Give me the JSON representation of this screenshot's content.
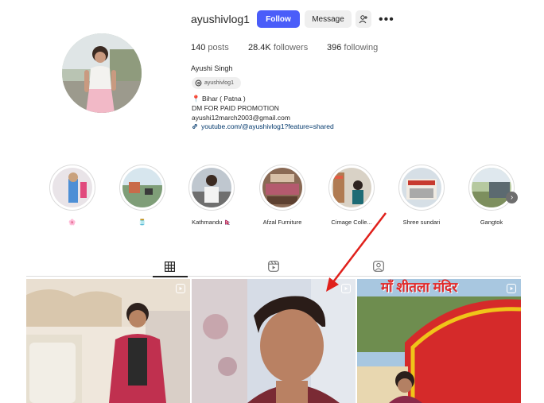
{
  "profile": {
    "username": "ayushivlog1",
    "follow_label": "Follow",
    "message_label": "Message",
    "more_label": "•••",
    "posts_count": "140",
    "posts_label": "posts",
    "followers_count": "28.4K",
    "followers_label": "followers",
    "following_count": "396",
    "following_label": "following",
    "full_name": "Ayushi Singh",
    "threads_handle": "ayushivlog1",
    "bio_location": "📍 Bihar ( Patna )",
    "bio_line2": "DM FOR PAID PROMOTION",
    "bio_email": "ayushi12march2003@gmail.com",
    "link": "youtube.com/@ayushivlog1?feature=shared"
  },
  "highlights": [
    {
      "label": "🌸"
    },
    {
      "label": "🫙"
    },
    {
      "label": "Kathmandu 🇳🇵"
    },
    {
      "label": "Afzal Furniture"
    },
    {
      "label": "Cimage Colle..."
    },
    {
      "label": "Shree sundari"
    },
    {
      "label": "Gangtok"
    }
  ],
  "tabs": [
    {
      "name": "posts",
      "icon": "grid-icon",
      "active": true
    },
    {
      "name": "reels",
      "icon": "reels-icon",
      "active": false
    },
    {
      "name": "tagged",
      "icon": "tagged-icon",
      "active": false
    }
  ],
  "posts": [
    {
      "type": "reel",
      "caption": ""
    },
    {
      "type": "reel",
      "caption": ""
    },
    {
      "type": "reel",
      "caption": "माँ शीतला मंदिर"
    }
  ],
  "colors": {
    "follow_button": "#4a5df9",
    "secondary_button": "#efefef",
    "annotation_arrow": "#e0201b"
  }
}
